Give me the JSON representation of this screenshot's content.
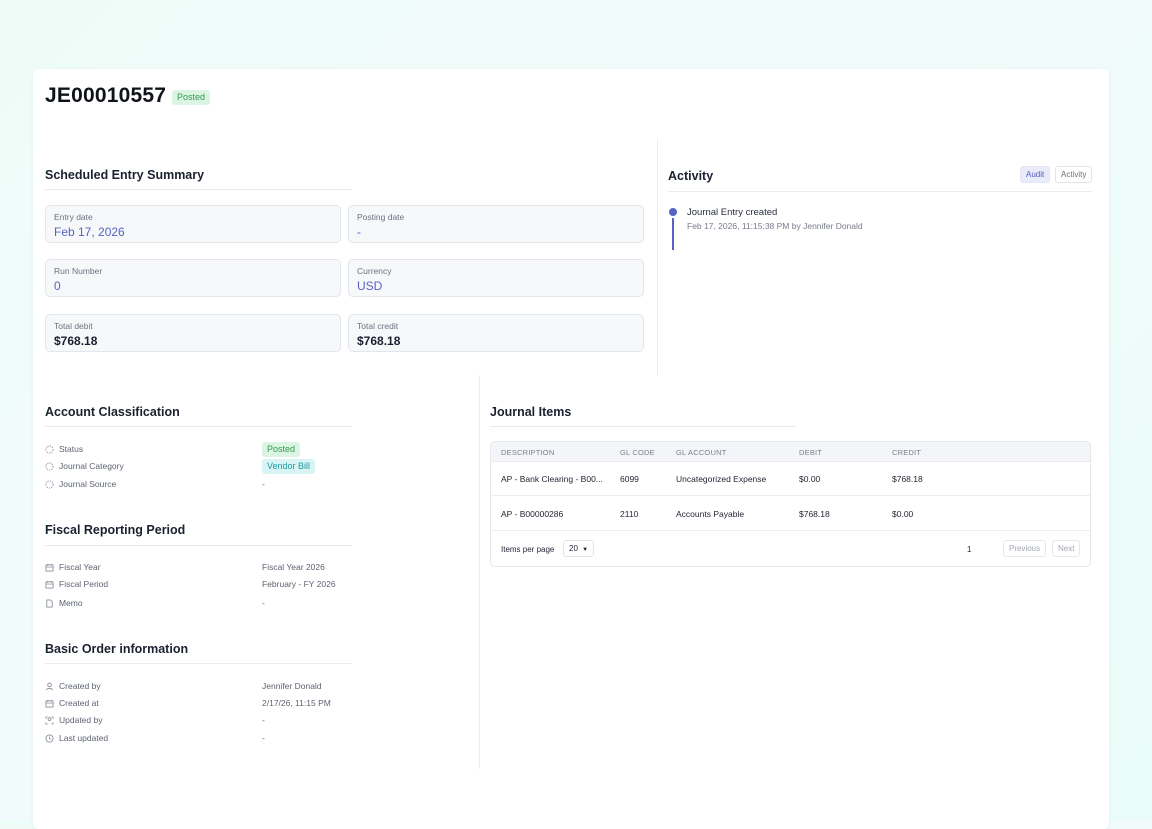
{
  "header": {
    "entry_id": "JE00010557",
    "status": "Posted"
  },
  "summary": {
    "title": "Scheduled Entry Summary",
    "fields": [
      {
        "label": "Entry date",
        "value": "Feb 17, 2026"
      },
      {
        "label": "Posting date",
        "value": "-"
      },
      {
        "label": "Run Number",
        "value": "0"
      },
      {
        "label": "Currency",
        "value": "USD"
      },
      {
        "label": "Total debit",
        "value": "$768.18"
      },
      {
        "label": "Total credit",
        "value": "$768.18"
      }
    ]
  },
  "activity": {
    "title": "Activity",
    "tabs": [
      "Audit",
      "Activity"
    ],
    "events": [
      {
        "title": "Journal Entry created",
        "meta": "Feb 17, 2026, 11:15:38 PM by Jennifer Donald"
      }
    ]
  },
  "classification": {
    "title": "Account Classification",
    "rows": [
      {
        "label": "Status",
        "value": "Posted",
        "icon": "dashed-circle-icon"
      },
      {
        "label": "Journal Category",
        "value": "Vendor Bill",
        "icon": "dashed-circle-icon"
      },
      {
        "label": "Journal Source",
        "value": "-",
        "icon": "dashed-circle-icon"
      }
    ]
  },
  "fiscal": {
    "title": "Fiscal Reporting Period",
    "rows": [
      {
        "label": "Fiscal Year",
        "value": "Fiscal Year 2026",
        "icon": "calendar-icon"
      },
      {
        "label": "Fiscal Period",
        "value": "February - FY 2026",
        "icon": "calendar-icon"
      },
      {
        "label": "Memo",
        "value": "-",
        "icon": "document-icon"
      }
    ]
  },
  "order": {
    "title": "Basic Order information",
    "rows": [
      {
        "label": "Created by",
        "value": "Jennifer Donald",
        "icon": "user-icon"
      },
      {
        "label": "Created at",
        "value": "2/17/26, 11:15 PM",
        "icon": "calendar-icon"
      },
      {
        "label": "Updated by",
        "value": "-",
        "icon": "user-dashed-icon"
      },
      {
        "label": "Last updated",
        "value": "-",
        "icon": "clock-icon"
      }
    ]
  },
  "journal": {
    "title": "Journal Items",
    "columns": [
      "DESCRIPTION",
      "GL CODE",
      "GL ACCOUNT",
      "DEBIT",
      "CREDIT"
    ],
    "rows": [
      [
        "AP - Bank Clearing - B00...",
        "6099",
        "Uncategorized Expense",
        "$0.00",
        "$768.18"
      ],
      [
        "AP - B00000286",
        "2110",
        "Accounts Payable",
        "$768.18",
        "$0.00"
      ]
    ],
    "items_per_page_label": "Items per page",
    "items_per_page": "20",
    "page": "1",
    "prev_label": "Previous",
    "next_label": "Next"
  },
  "colors": {
    "accent": "#5663c4",
    "posted": "#2f9a52",
    "vendor_bill": "#1e9aa0"
  }
}
